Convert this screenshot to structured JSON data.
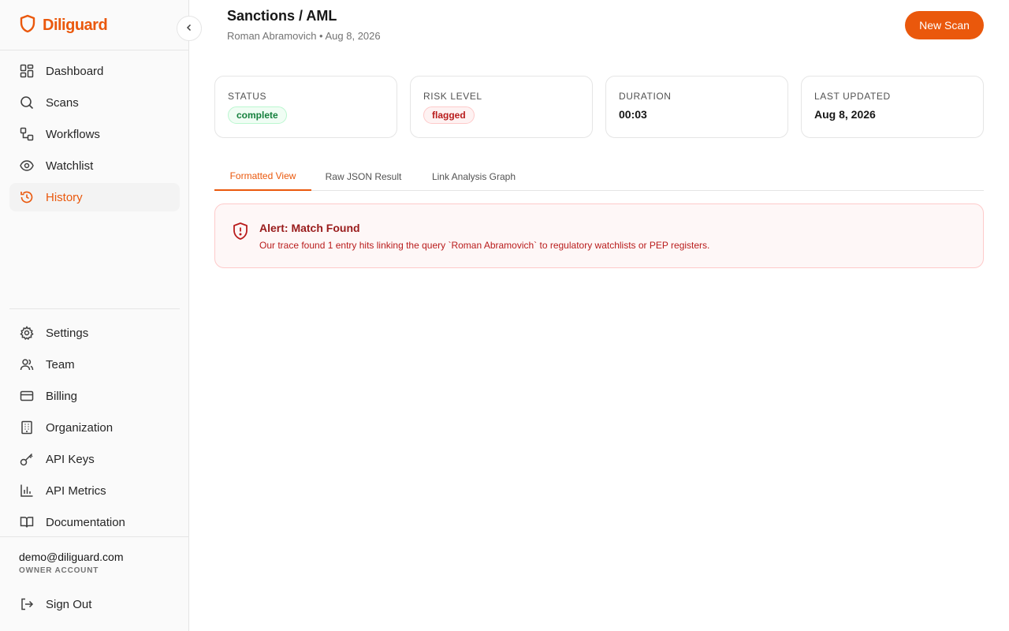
{
  "brand": {
    "name": "Diliguard",
    "accent": "#ea580c"
  },
  "sidebar": {
    "nav": [
      {
        "label": "Dashboard",
        "icon": "dashboard-icon"
      },
      {
        "label": "Scans",
        "icon": "search-icon"
      },
      {
        "label": "Workflows",
        "icon": "workflow-icon"
      },
      {
        "label": "Watchlist",
        "icon": "eye-icon"
      },
      {
        "label": "History",
        "icon": "history-icon",
        "active": true
      }
    ],
    "secondary": [
      {
        "label": "Settings",
        "icon": "gear-icon"
      },
      {
        "label": "Team",
        "icon": "users-icon"
      },
      {
        "label": "Billing",
        "icon": "credit-card-icon"
      },
      {
        "label": "Organization",
        "icon": "building-icon"
      },
      {
        "label": "API Keys",
        "icon": "key-icon"
      },
      {
        "label": "API Metrics",
        "icon": "bar-chart-icon"
      },
      {
        "label": "Documentation",
        "icon": "book-icon"
      }
    ],
    "account": {
      "email": "demo@diliguard.com",
      "role": "OWNER ACCOUNT"
    },
    "sign_out": "Sign Out"
  },
  "header": {
    "title": "Sanctions / AML",
    "subtitle": "Roman Abramovich • Aug 8, 2026",
    "new_scan": "New Scan"
  },
  "cards": {
    "status": {
      "label": "STATUS",
      "value": "complete"
    },
    "risk": {
      "label": "RISK LEVEL",
      "value": "flagged"
    },
    "duration": {
      "label": "DURATION",
      "value": "00:03"
    },
    "updated": {
      "label": "LAST UPDATED",
      "value": "Aug 8, 2026"
    }
  },
  "tabs": [
    "Formatted View",
    "Raw JSON Result",
    "Link Analysis Graph"
  ],
  "alert": {
    "title": "Alert: Match Found",
    "text": "Our trace found 1 entry hits linking the query `Roman Abramovich` to regulatory watchlists or PEP registers."
  }
}
